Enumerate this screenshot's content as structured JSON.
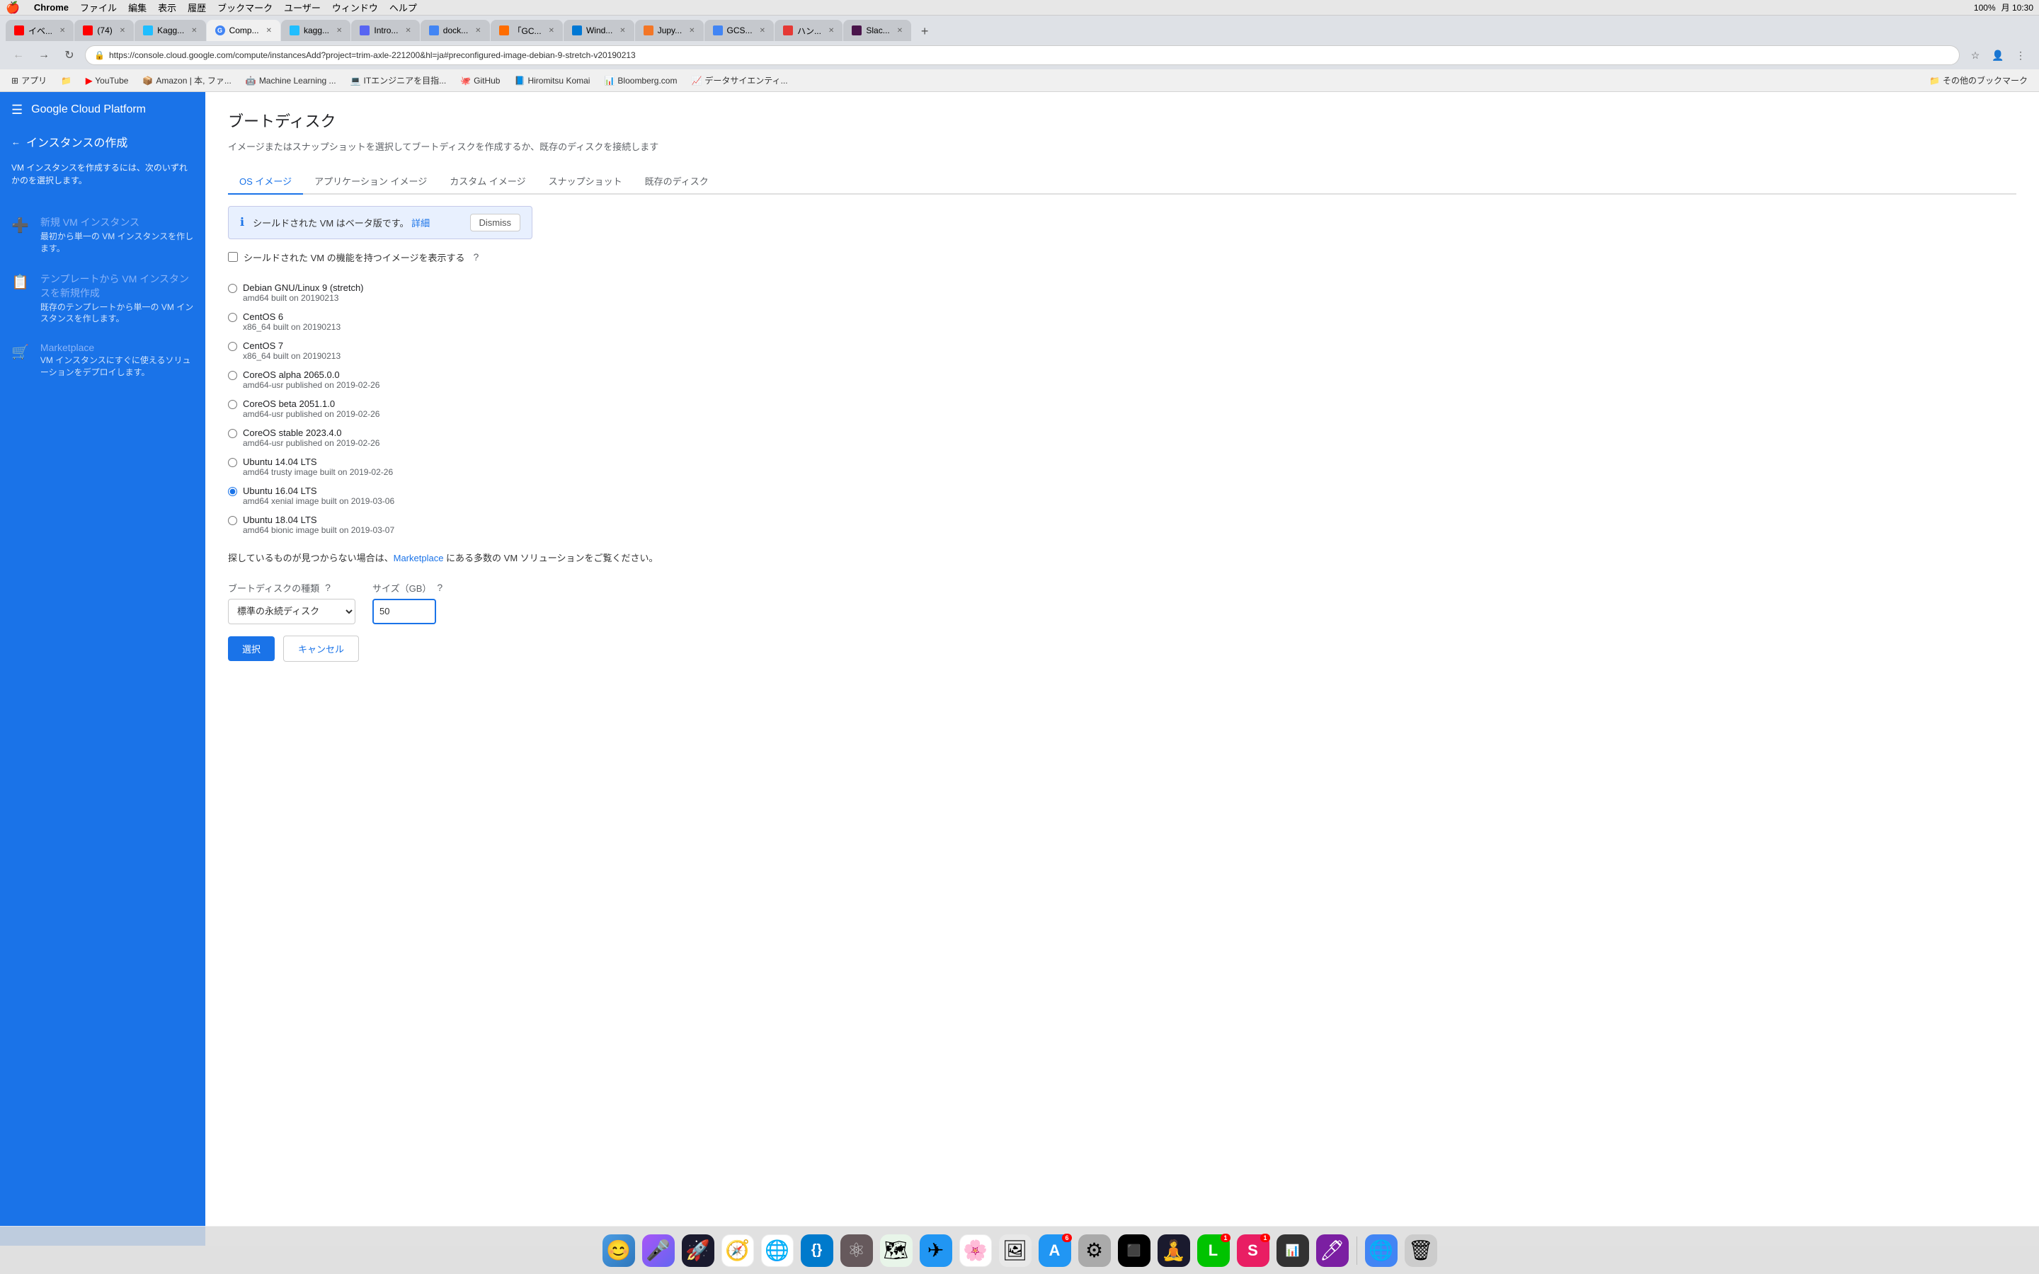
{
  "menubar": {
    "apple": "🍎",
    "items": [
      "Chrome",
      "ファイル",
      "編集",
      "表示",
      "履歴",
      "ブックマーク",
      "ユーザー",
      "ウィンドウ",
      "ヘルプ"
    ],
    "right": {
      "time": "月 10:30",
      "battery": "100%"
    }
  },
  "tabs": [
    {
      "id": "event",
      "label": "イベ...",
      "favicon_color": "#ff0000",
      "active": false
    },
    {
      "id": "yt74",
      "label": "(74)",
      "favicon_color": "#ff0000",
      "active": false
    },
    {
      "id": "kaggle",
      "label": "Kagg...",
      "favicon_color": "#20beff",
      "active": false
    },
    {
      "id": "compute",
      "label": "Comp...",
      "favicon_color": "#4285f4",
      "active": true
    },
    {
      "id": "kaggle2",
      "label": "kagg...",
      "favicon_color": "#20beff",
      "active": false
    },
    {
      "id": "intro",
      "label": "Intro...",
      "favicon_color": "#5865F2",
      "active": false
    },
    {
      "id": "doc",
      "label": "dock...",
      "favicon_color": "#4285f4",
      "active": false
    },
    {
      "id": "gcf",
      "label": "「GC...",
      "favicon_color": "#ff6d00",
      "active": false
    },
    {
      "id": "win",
      "label": "Wind...",
      "favicon_color": "#0078d4",
      "active": false
    },
    {
      "id": "jup",
      "label": "Jupy...",
      "favicon_color": "#f37626",
      "active": false
    },
    {
      "id": "gcs",
      "label": "GCS...",
      "favicon_color": "#4285f4",
      "active": false
    },
    {
      "id": "han",
      "label": "ハン...",
      "favicon_color": "#e53935",
      "active": false
    },
    {
      "id": "slack",
      "label": "Slac...",
      "favicon_color": "#4a154b",
      "active": false
    }
  ],
  "address_bar": {
    "url": "https://console.cloud.google.com/compute/instancesAdd?project=trim-axle-221200&hl=ja#preconfigured-image-debian-9-stretch-v20190213",
    "lock_icon": "🔒"
  },
  "bookmarks": [
    {
      "label": "アプリ",
      "icon": "⊞"
    },
    {
      "label": "",
      "icon": "📁"
    },
    {
      "label": "YouTube",
      "icon": "▶"
    },
    {
      "label": "Amazon | 本, ファ...",
      "icon": "📦"
    },
    {
      "label": "Machine Learning ...",
      "icon": "🤖"
    },
    {
      "label": "ITエンジニアを目指...",
      "icon": "💻"
    },
    {
      "label": "GitHub",
      "icon": "🐙"
    },
    {
      "label": "Hiromitsu Komai",
      "icon": "📘"
    },
    {
      "label": "Bloomberg.com",
      "icon": "📊"
    },
    {
      "label": "データサイエンティ...",
      "icon": "📈"
    },
    {
      "label": "その他のブックマーク",
      "icon": "📁"
    }
  ],
  "sidebar": {
    "header": {
      "menu_icon": "☰",
      "title": "Google Cloud Platform"
    },
    "back_text": "インスタンスの作成",
    "description": "VM インスタンスを作成するには、次のいずれかのを選択します。",
    "items": [
      {
        "icon": "➕",
        "title": "新規 VM インスタンス",
        "desc": "最初から単一の VM インスタンスを作します。"
      },
      {
        "icon": "📋",
        "title": "テンプレートから VM インスタンスを新規作成",
        "desc": "既存のテンプレートから単一の VM インスタンスを作します。"
      },
      {
        "icon": "🛒",
        "title": "Marketplace",
        "desc": "VM インスタンスにすぐに使えるソリューションをデプロイします。"
      }
    ]
  },
  "content": {
    "title": "ブートディスク",
    "subtitle": "イメージまたはスナップショットを選択してブートディスクを作成するか、既存のディスクを接続します",
    "tabs": [
      "OS イメージ",
      "アプリケーション イメージ",
      "カスタム イメージ",
      "スナップショット",
      "既存のディスク"
    ],
    "active_tab": 0,
    "beta_notice": {
      "text": "シールドされた VM はベータ版です。",
      "link": "詳細",
      "dismiss": "Dismiss"
    },
    "shield_check_label": "シールドされた VM の機能を持つイメージを表示する",
    "os_images": [
      {
        "name": "Debian GNU/Linux 9 (stretch)",
        "desc": "amd64 built on 20190213",
        "selected": false
      },
      {
        "name": "CentOS 6",
        "desc": "x86_64 built on 20190213",
        "selected": false
      },
      {
        "name": "CentOS 7",
        "desc": "x86_64 built on 20190213",
        "selected": false
      },
      {
        "name": "CoreOS alpha 2065.0.0",
        "desc": "amd64-usr published on 2019-02-26",
        "selected": false
      },
      {
        "name": "CoreOS beta 2051.1.0",
        "desc": "amd64-usr published on 2019-02-26",
        "selected": false
      },
      {
        "name": "CoreOS stable 2023.4.0",
        "desc": "amd64-usr published on 2019-02-26",
        "selected": false
      },
      {
        "name": "Ubuntu 14.04 LTS",
        "desc": "amd64 trusty image built on 2019-02-26",
        "selected": false
      },
      {
        "name": "Ubuntu 16.04 LTS",
        "desc": "amd64 xenial image built on 2019-03-06",
        "selected": true
      },
      {
        "name": "Ubuntu 18.04 LTS",
        "desc": "amd64 bionic image built on 2019-03-07",
        "selected": false
      }
    ],
    "marketplace_text": "探しているものが見つからない場合は、",
    "marketplace_link": "Marketplace",
    "marketplace_suffix": " にある多数の VM ソリューションをご覧ください。",
    "disk_type_label": "ブートディスクの種類",
    "disk_type_value": "標準の永続ディスク",
    "disk_type_help": "?",
    "size_label": "サイズ（GB）",
    "size_help": "?",
    "size_value": "50",
    "btn_select": "選択",
    "btn_cancel": "キャンセル"
  },
  "dock": {
    "items": [
      {
        "label": "Finder",
        "icon": "😊",
        "bg": "#4b9ce2"
      },
      {
        "label": "Siri",
        "icon": "🎤",
        "bg": "#6e5bc2"
      },
      {
        "label": "Launchpad",
        "icon": "🚀",
        "bg": "#222"
      },
      {
        "label": "Safari",
        "icon": "🧭",
        "bg": "#1477f8"
      },
      {
        "label": "Chrome",
        "icon": "🌐",
        "bg": "#fff"
      },
      {
        "label": "VSCode",
        "icon": "{}",
        "bg": "#007acc"
      },
      {
        "label": "Atom",
        "icon": "⚛",
        "bg": "#66595c"
      },
      {
        "label": "Maps",
        "icon": "🗺",
        "bg": "#4caf50"
      },
      {
        "label": "Airmail",
        "icon": "✈",
        "bg": "#2196f3"
      },
      {
        "label": "Photos",
        "icon": "🌸",
        "bg": "#fff"
      },
      {
        "label": "Preview",
        "icon": "🖼",
        "bg": "#e8e8e8"
      },
      {
        "label": "App Store",
        "icon": "A",
        "bg": "#2196f3",
        "badge": "6"
      },
      {
        "label": "System Prefs",
        "icon": "⚙",
        "bg": "#888"
      },
      {
        "label": "Terminal",
        "icon": "⬛",
        "bg": "#000"
      },
      {
        "label": "Silhouette",
        "icon": "🧘",
        "bg": "#1a1a2e"
      },
      {
        "label": "LINE",
        "icon": "L",
        "bg": "#00c300",
        "badge": "1"
      },
      {
        "label": "Sketchbook",
        "icon": "S",
        "bg": "#e91e63",
        "badge": "1"
      },
      {
        "label": "Activity Monitor",
        "icon": "📊",
        "bg": "#333"
      },
      {
        "label": "Marker",
        "icon": "🖊",
        "bg": "#7b1fa2"
      },
      {
        "label": "Preview2",
        "icon": "🗂",
        "bg": "#ccc"
      },
      {
        "label": "Chrome2",
        "icon": "🌐",
        "bg": "#4285f4"
      },
      {
        "label": "Trash",
        "icon": "🗑",
        "bg": "#999"
      }
    ]
  }
}
